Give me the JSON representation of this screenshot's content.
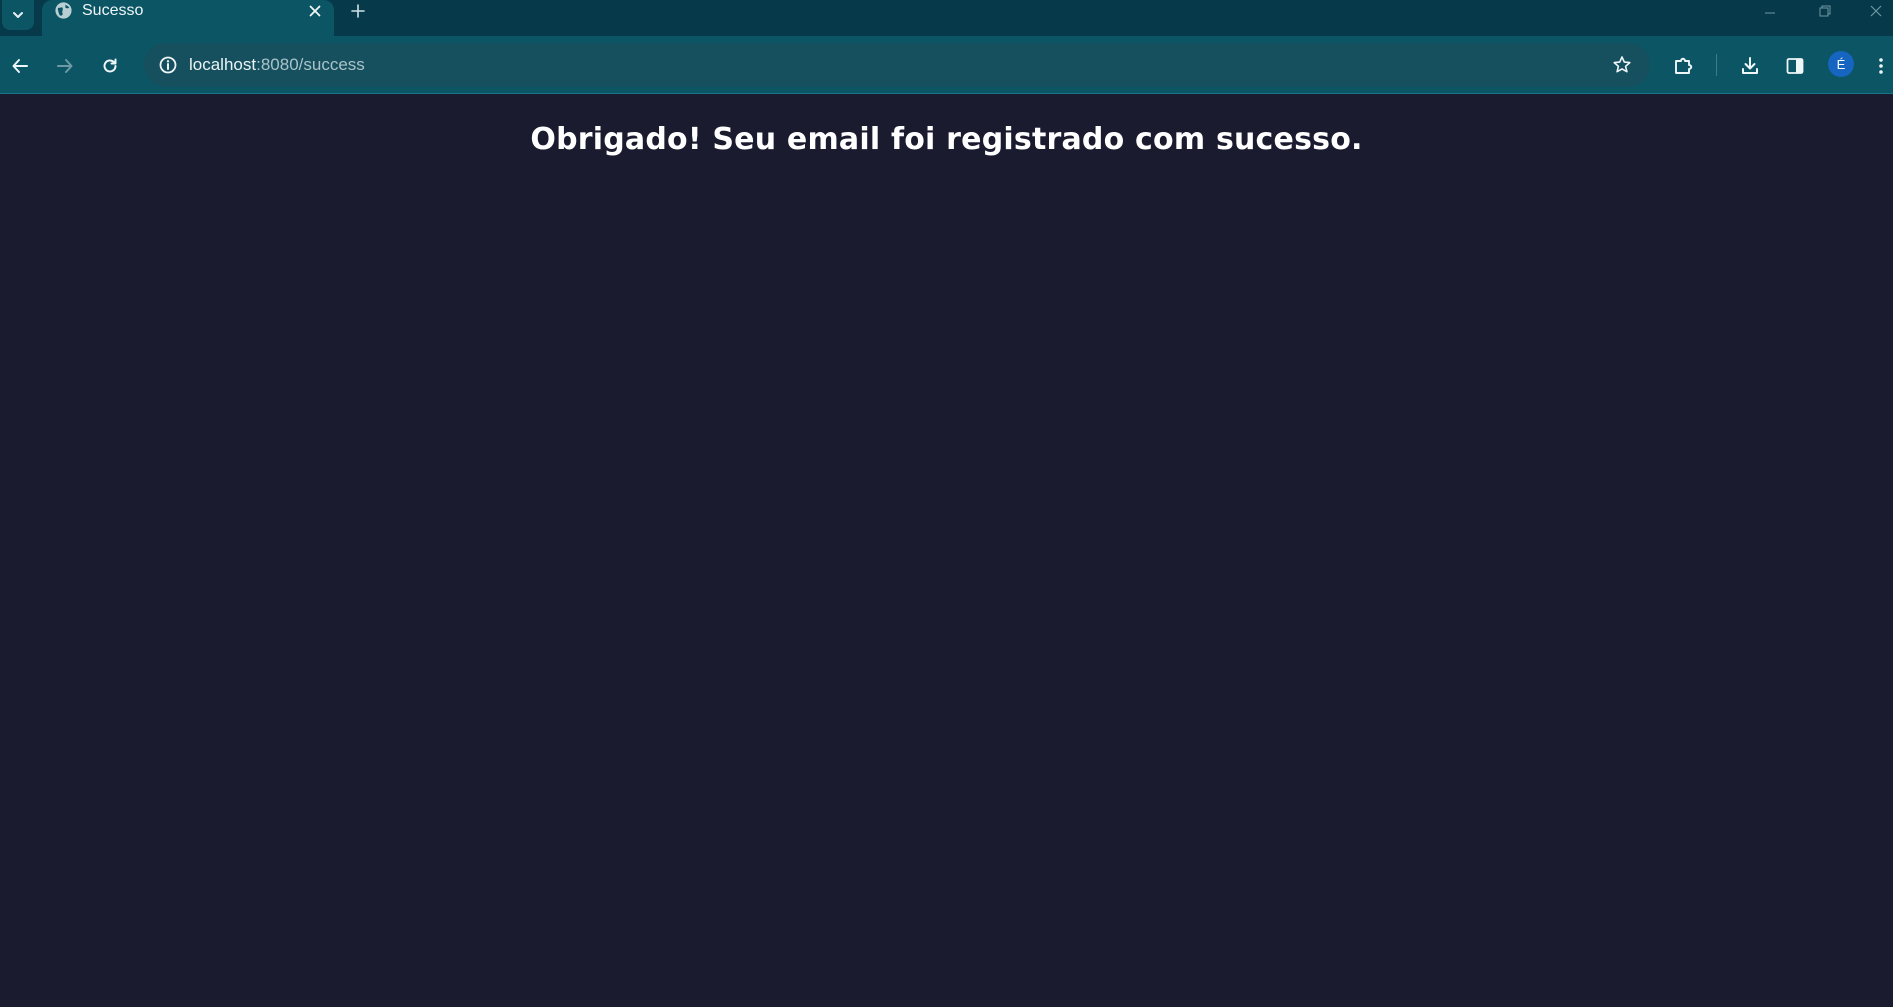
{
  "browser": {
    "tab": {
      "title": "Sucesso",
      "favicon": "globe-icon"
    },
    "address_bar": {
      "host": "localhost",
      "path": ":8080/success",
      "info_icon": "info-icon"
    },
    "profile_initial": "É",
    "colors": {
      "tab_strip": "#06394a",
      "toolbar": "#0b5565",
      "omnibox": "#164f5e",
      "avatar": "#1665c0"
    }
  },
  "page": {
    "message": "Obrigado! Seu email foi registrado com sucesso.",
    "background": "#1b1b30",
    "text_color": "#ffffff"
  }
}
